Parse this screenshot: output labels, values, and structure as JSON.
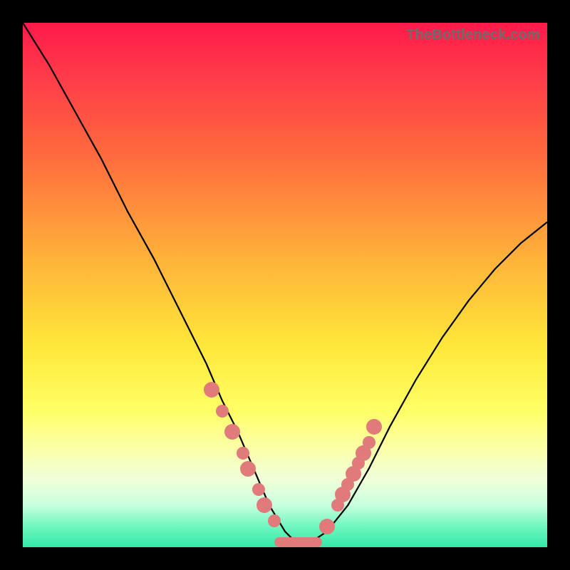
{
  "watermark": "TheBottleneck.com",
  "colors": {
    "frame": "#000000",
    "curve": "#000000",
    "marker": "#e17a7a"
  },
  "chart_data": {
    "type": "line",
    "title": "",
    "xlabel": "",
    "ylabel": "",
    "xlim": [
      0,
      100
    ],
    "ylim": [
      0,
      100
    ],
    "grid": false,
    "legend": false,
    "series": [
      {
        "name": "bottleneck-curve",
        "x": [
          0,
          5,
          10,
          15,
          20,
          25,
          30,
          35,
          38,
          41,
          44,
          47,
          50,
          52,
          55,
          58,
          62,
          66,
          70,
          75,
          80,
          85,
          90,
          95,
          100
        ],
        "y": [
          100,
          92,
          83,
          74,
          64,
          55,
          45,
          35,
          28,
          22,
          15,
          8,
          3,
          1,
          1,
          3,
          8,
          15,
          23,
          32,
          40,
          47,
          53,
          58,
          62
        ]
      }
    ],
    "markers": {
      "left_cluster_x": [
        36,
        38,
        40,
        42,
        43,
        45,
        46,
        48
      ],
      "left_cluster_y": [
        30,
        26,
        22,
        18,
        15,
        11,
        8,
        5
      ],
      "right_cluster_x": [
        58,
        60,
        61,
        62,
        63,
        64,
        65,
        66,
        67
      ],
      "right_cluster_y": [
        4,
        8,
        10,
        12,
        14,
        16,
        18,
        20,
        23
      ],
      "trough_x_range": [
        48,
        57
      ],
      "trough_y": 1
    },
    "background_gradient": {
      "top": "#ff1a4a",
      "bottom": "#34e8a8",
      "note": "vertical red→yellow→green gradient representing score quality"
    }
  }
}
